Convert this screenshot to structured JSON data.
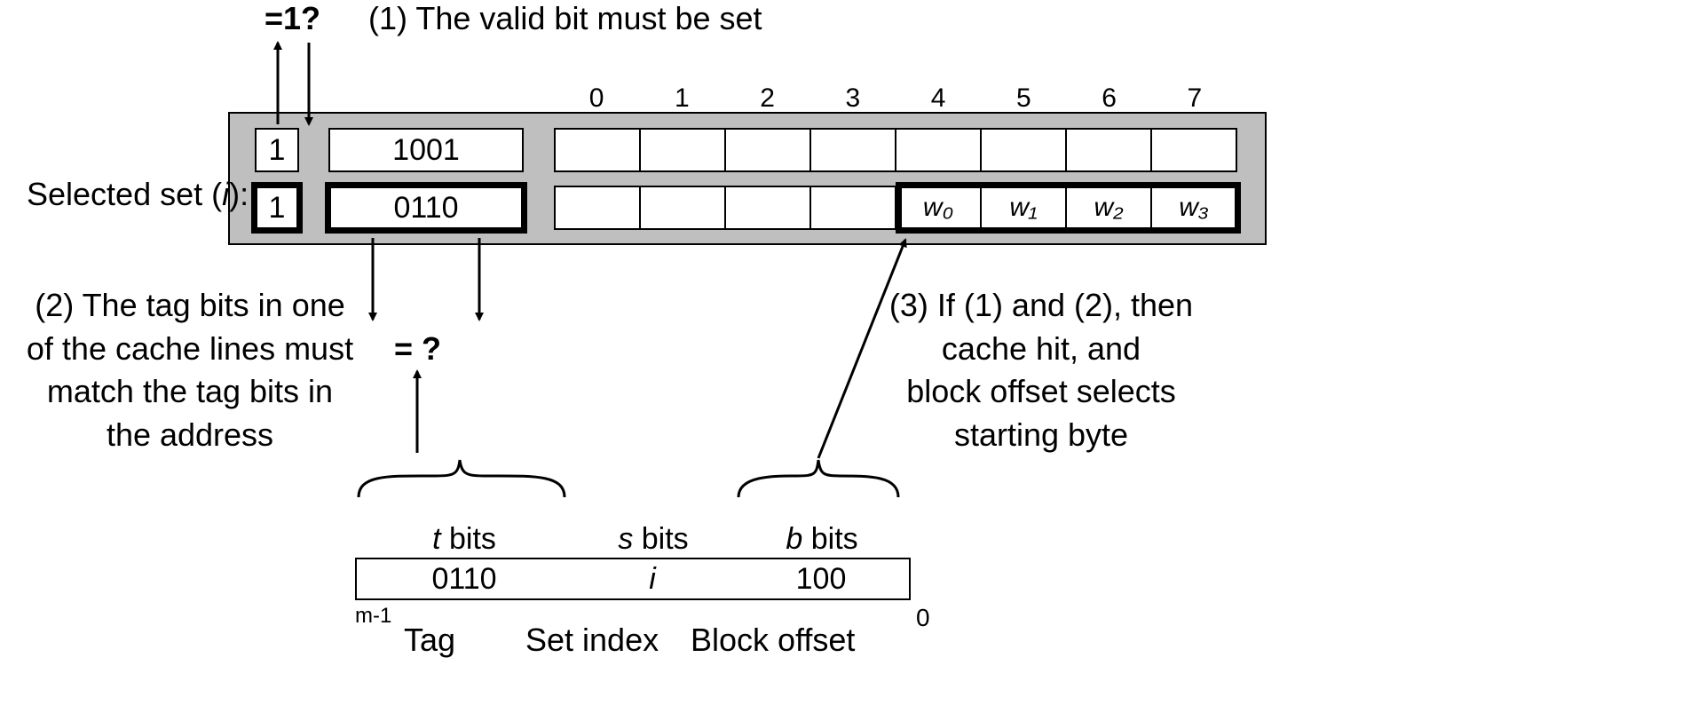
{
  "top": {
    "valid_q": "=1?",
    "cond1": "(1) The valid bit must be set"
  },
  "side": {
    "selected_set": "Selected set (i):"
  },
  "col_indices": [
    "0",
    "1",
    "2",
    "3",
    "4",
    "5",
    "6",
    "7"
  ],
  "rows": {
    "r1_valid": "1",
    "r1_tag": "1001",
    "r2_valid": "1",
    "r2_tag": "0110",
    "r2_bytes": [
      "",
      "",
      "",
      "",
      "w₀",
      "w₁",
      "w₂",
      "w₃"
    ]
  },
  "mid": {
    "eq_q": "= ?"
  },
  "cond2": {
    "l1": "(2) The tag bits in one",
    "l2": "of the cache lines must",
    "l3": "match the tag bits in",
    "l4": "the address"
  },
  "cond3": {
    "l1": "(3) If (1) and (2), then",
    "l2": "cache hit, and",
    "l3": "block  offset selects",
    "l4": "starting byte"
  },
  "addr": {
    "t_bits": "t bits",
    "s_bits": "s bits",
    "b_bits": "b bits",
    "tag_val": "0110",
    "set_val": "i",
    "off_val": "100",
    "m_minus_1": "m-1",
    "zero": "0",
    "tag_lbl": "Tag",
    "set_lbl": "Set index",
    "off_lbl": "Block offset"
  }
}
